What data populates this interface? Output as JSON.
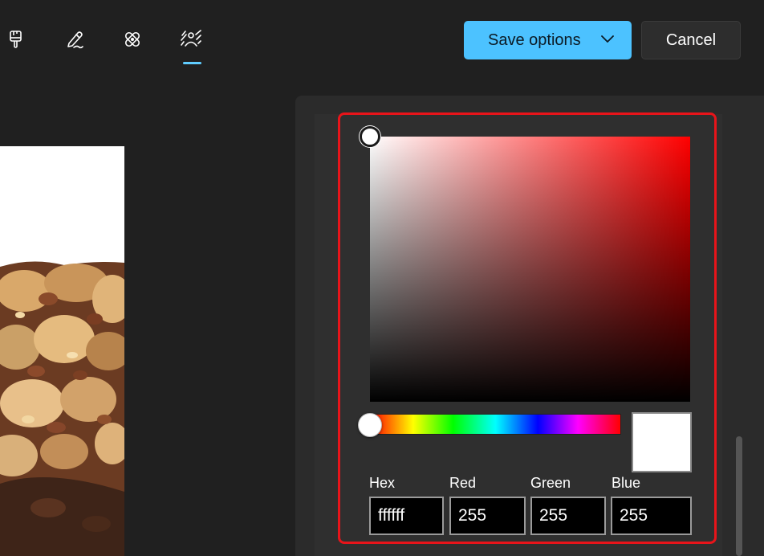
{
  "toolbar": {
    "icons": [
      "paint-brush-icon",
      "pen-markup-icon",
      "retouch-bandage-icon",
      "background-blur-icon"
    ],
    "active_icon": "background-blur-icon",
    "accent_color": "#60cdff",
    "save_label": "Save options",
    "cancel_label": "Cancel"
  },
  "color_picker": {
    "selected_hex": "#ffffff",
    "hue_color": "#ff0000",
    "highlight_color": "#e8141a",
    "fields": [
      {
        "label": "Hex",
        "value": "ffffff"
      },
      {
        "label": "Red",
        "value": "255"
      },
      {
        "label": "Green",
        "value": "255"
      },
      {
        "label": "Blue",
        "value": "255"
      }
    ]
  }
}
